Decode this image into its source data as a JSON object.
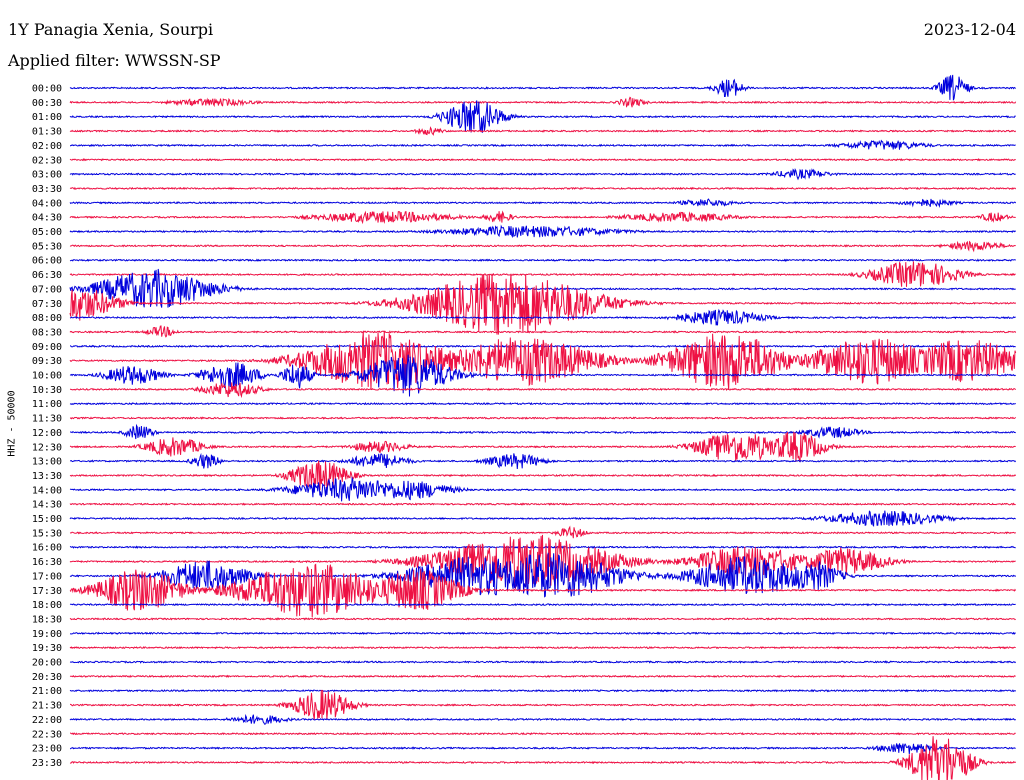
{
  "header": {
    "station": "1Y Panagia Xenia, Sourpi",
    "date": "2023-12-04",
    "filter": "Applied filter: WWSSN-SP"
  },
  "chart_data": {
    "type": "line",
    "subtype": "helicorder",
    "ylabel": "HHZ - 50000",
    "row_colors": [
      "#0000dd",
      "#ee1144"
    ],
    "rows": [
      "00:00",
      "00:30",
      "01:00",
      "01:30",
      "02:00",
      "02:30",
      "03:00",
      "03:30",
      "04:00",
      "04:30",
      "05:00",
      "05:30",
      "06:00",
      "06:30",
      "07:00",
      "07:30",
      "08:00",
      "08:30",
      "09:00",
      "09:30",
      "10:00",
      "10:30",
      "11:00",
      "11:30",
      "12:00",
      "12:30",
      "13:00",
      "13:30",
      "14:00",
      "14:30",
      "15:00",
      "15:30",
      "16:00",
      "16:30",
      "17:00",
      "17:30",
      "18:00",
      "18:30",
      "19:00",
      "19:30",
      "20:00",
      "20:30",
      "21:00",
      "21:30",
      "22:00",
      "22:30",
      "23:00",
      "23:30"
    ],
    "x_range_minutes": [
      0,
      30
    ],
    "activity": [
      {
        "row": 0,
        "events": [
          [
            20.9,
            10,
            1
          ],
          [
            28.0,
            14,
            1
          ]
        ]
      },
      {
        "row": 1,
        "events": [
          [
            4.5,
            4,
            3
          ],
          [
            17.8,
            5,
            1
          ]
        ]
      },
      {
        "row": 2,
        "events": [
          [
            12.8,
            18,
            2
          ]
        ]
      },
      {
        "row": 3,
        "events": [
          [
            11.4,
            4,
            1
          ]
        ]
      },
      {
        "row": 4,
        "events": [
          [
            25.8,
            5,
            3
          ]
        ]
      },
      {
        "row": 6,
        "events": [
          [
            23.2,
            5,
            2
          ]
        ]
      },
      {
        "row": 8,
        "events": [
          [
            20.2,
            4,
            2
          ],
          [
            27.2,
            4,
            2
          ]
        ]
      },
      {
        "row": 9,
        "events": [
          [
            10.0,
            6,
            5
          ],
          [
            13.6,
            6,
            1
          ],
          [
            19.3,
            5,
            4
          ],
          [
            29.3,
            5,
            1
          ]
        ]
      },
      {
        "row": 10,
        "events": [
          [
            14.6,
            6,
            6
          ]
        ]
      },
      {
        "row": 11,
        "events": [
          [
            28.7,
            5,
            2
          ]
        ]
      },
      {
        "row": 13,
        "events": [
          [
            26.8,
            14,
            3
          ]
        ]
      },
      {
        "row": 14,
        "events": [
          [
            2.7,
            20,
            4
          ]
        ]
      },
      {
        "row": 15,
        "events": [
          [
            0.1,
            18,
            3
          ],
          [
            13.9,
            32,
            6
          ]
        ]
      },
      {
        "row": 16,
        "events": [
          [
            20.6,
            8,
            3
          ]
        ]
      },
      {
        "row": 17,
        "events": [
          [
            2.9,
            6,
            1
          ]
        ]
      },
      {
        "row": 19,
        "events": [
          [
            9.8,
            30,
            5
          ],
          [
            14.4,
            25,
            5
          ],
          [
            20.8,
            30,
            4
          ],
          [
            25.4,
            25,
            4
          ],
          [
            28.4,
            22,
            4
          ]
        ]
      },
      {
        "row": 20,
        "events": [
          [
            2.0,
            10,
            2
          ],
          [
            5.1,
            14,
            2
          ],
          [
            7.2,
            14,
            1
          ],
          [
            10.7,
            22,
            3
          ]
        ]
      },
      {
        "row": 21,
        "events": [
          [
            5.1,
            8,
            2
          ]
        ]
      },
      {
        "row": 24,
        "events": [
          [
            2.2,
            8,
            1
          ],
          [
            24.2,
            6,
            2
          ]
        ]
      },
      {
        "row": 25,
        "events": [
          [
            3.3,
            10,
            2
          ],
          [
            9.8,
            6,
            2
          ],
          [
            21.2,
            16,
            3
          ],
          [
            23.0,
            16,
            2
          ]
        ]
      },
      {
        "row": 26,
        "events": [
          [
            4.3,
            8,
            1
          ],
          [
            9.8,
            8,
            2
          ],
          [
            14.1,
            8,
            2
          ]
        ]
      },
      {
        "row": 27,
        "events": [
          [
            7.9,
            16,
            2
          ]
        ]
      },
      {
        "row": 28,
        "events": [
          [
            8.9,
            12,
            4
          ],
          [
            10.7,
            10,
            3
          ]
        ]
      },
      {
        "row": 31,
        "events": [
          [
            15.9,
            6,
            1
          ]
        ]
      },
      {
        "row": 30,
        "events": [
          [
            25.8,
            8,
            4
          ]
        ]
      },
      {
        "row": 33,
        "events": [
          [
            14.4,
            28,
            6
          ],
          [
            21.5,
            16,
            4
          ],
          [
            24.5,
            14,
            3
          ]
        ]
      },
      {
        "row": 34,
        "events": [
          [
            4.3,
            16,
            3
          ],
          [
            13.0,
            20,
            5
          ],
          [
            15.2,
            24,
            5
          ],
          [
            21.5,
            20,
            4
          ],
          [
            23.5,
            16,
            2
          ]
        ]
      },
      {
        "row": 35,
        "events": [
          [
            2.2,
            22,
            3
          ],
          [
            7.6,
            28,
            5
          ],
          [
            11.0,
            22,
            3
          ]
        ]
      },
      {
        "row": 43,
        "events": [
          [
            8.0,
            16,
            2
          ]
        ]
      },
      {
        "row": 44,
        "events": [
          [
            6.0,
            5,
            2
          ]
        ]
      },
      {
        "row": 46,
        "events": [
          [
            26.5,
            6,
            2
          ]
        ]
      },
      {
        "row": 47,
        "events": [
          [
            27.6,
            30,
            2
          ]
        ]
      }
    ]
  }
}
